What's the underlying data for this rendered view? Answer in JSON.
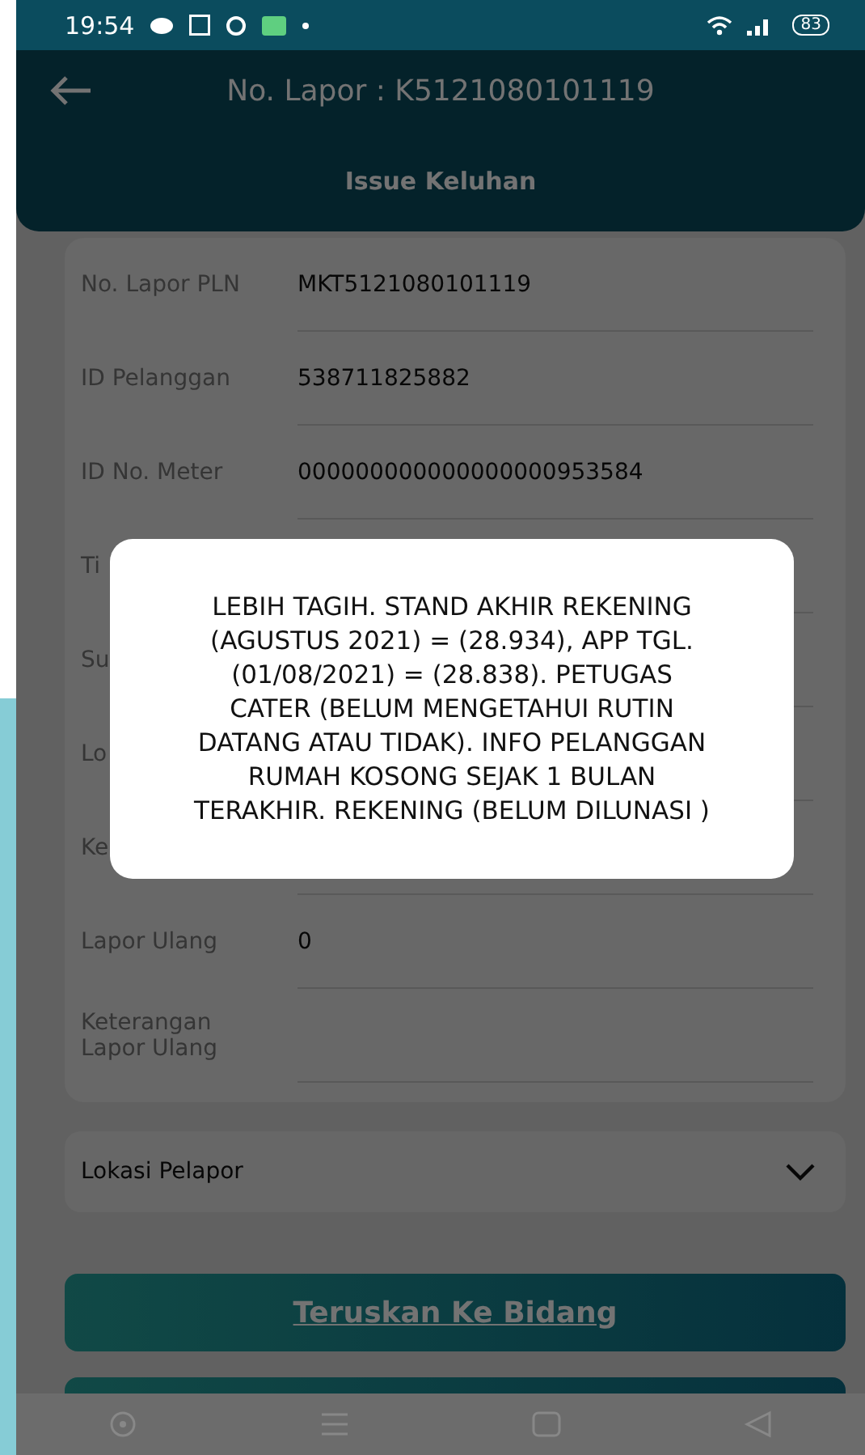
{
  "status_bar": {
    "time": "19:54",
    "battery": "83"
  },
  "app_bar": {
    "title": "No. Lapor : K5121080101119"
  },
  "tabs": [
    {
      "label": "Issue Keluhan",
      "selected": true
    }
  ],
  "fields": [
    {
      "label": "No. Lapor PLN",
      "value": "MKT5121080101119"
    },
    {
      "label": "ID Pelanggan",
      "value": "538711825882"
    },
    {
      "label": "ID No. Meter",
      "value": "000000000000000000953584"
    },
    {
      "label": "Ti"
    },
    {
      "label": "Su"
    },
    {
      "label": "Lo"
    },
    {
      "label": "Ke"
    },
    {
      "label": "Lapor Ulang",
      "value": "0"
    },
    {
      "label": "Keterangan Lapor Ulang"
    }
  ],
  "section": {
    "label": "Lokasi Pelapor",
    "expanded": false
  },
  "buttons": [
    {
      "label": "Teruskan Ke Bidang"
    }
  ],
  "dialog": {
    "message": "LEBIH TAGIH. STAND AKHIR REKENING (AGUSTUS 2021) = (28.934), APP TGL. (01/08/2021) = (28.838). PETUGAS CATER (BELUM MENGETAHUI RUTIN DATANG ATAU TIDAK). INFO PELANGGAN RUMAH KOSONG SEJAK 1 BULAN TERAKHIR. REKENING (BELUM DILUNASI )"
  }
}
